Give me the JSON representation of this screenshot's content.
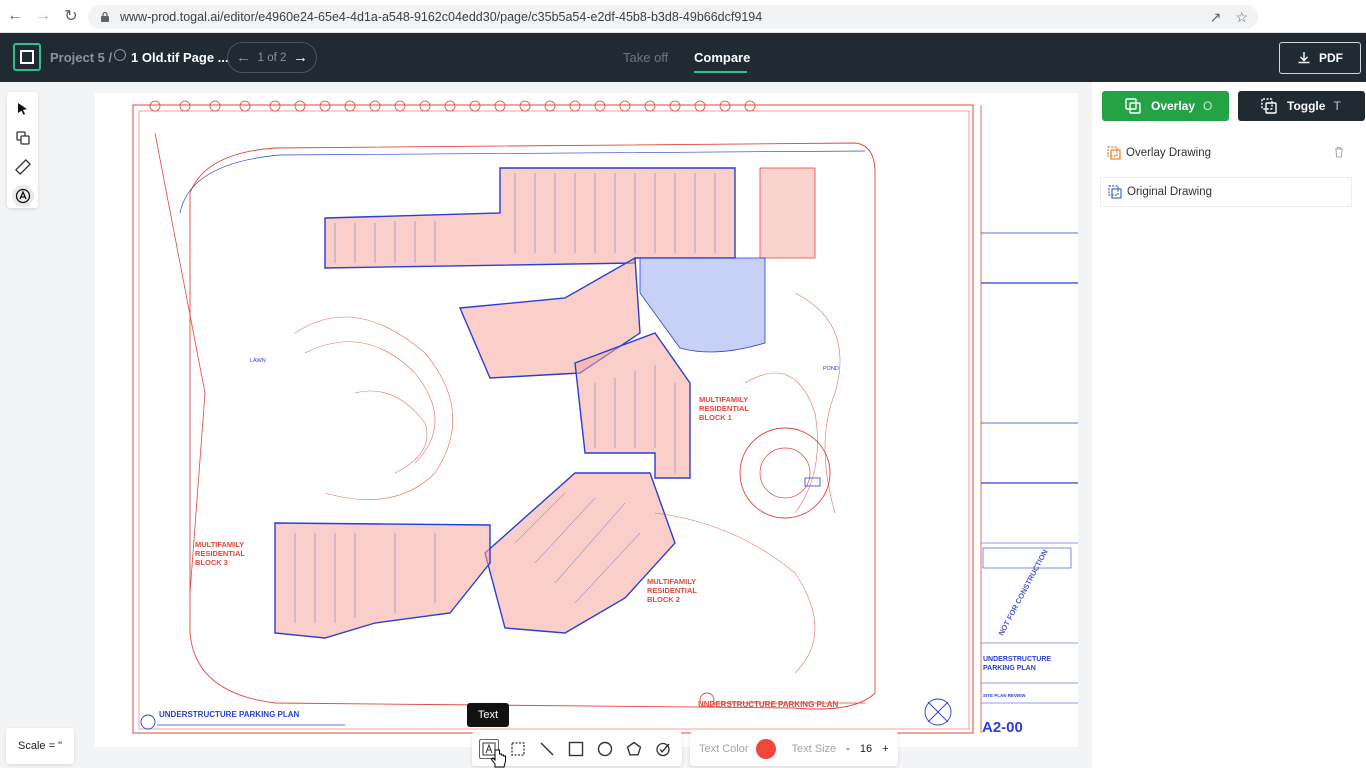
{
  "browser": {
    "url": "www-prod.togal.ai/editor/e4960e24-65e4-4d1a-a548-9162c04edd30/page/c35b5a54-e2df-45b8-b3d8-49b66dcf9194"
  },
  "header": {
    "project": "Project 5 /",
    "file": "1 Old.tif Page ...",
    "pager": "1 of 2",
    "tabs": {
      "takeoff": "Take off",
      "compare": "Compare"
    },
    "pdf_label": "PDF"
  },
  "panel": {
    "overlay": {
      "label": "Overlay",
      "key": "O"
    },
    "toggle": {
      "label": "Toggle",
      "key": "T"
    },
    "layers": [
      {
        "name": "Overlay Drawing"
      },
      {
        "name": "Original Drawing"
      }
    ]
  },
  "drawing": {
    "blocks": [
      "MULTIFAMILY",
      "RESIDENTIAL",
      "BLOCK 1",
      "BLOCK 2",
      "BLOCK 3"
    ],
    "title_left": "UNDERSTRUCTURE PARKING PLAN",
    "title_right": "UNDERSTRUCTURE PARKING PLAN",
    "sheet_title": "UNDERSTRUCTURE PARKING PLAN",
    "sheet_sub": "SITE PLAN REVIEW",
    "sheet_no": "A2-00",
    "stamp": "NOT FOR CONSTRUCTION",
    "pond": "POND",
    "lawn": "LAWN"
  },
  "bottom": {
    "scale": "Scale = \"",
    "tooltip": "Text",
    "text_color_label": "Text Color",
    "text_color": "#f0463c",
    "text_size_label": "Text Size",
    "text_size": "16",
    "minus": "-",
    "plus": "+"
  },
  "colors": {
    "accent": "#2fbf8a",
    "overlay_green": "#24a344",
    "header_dark": "#1f2a33",
    "plan_red": "#e0483e",
    "plan_blue": "#2b3fd1"
  }
}
